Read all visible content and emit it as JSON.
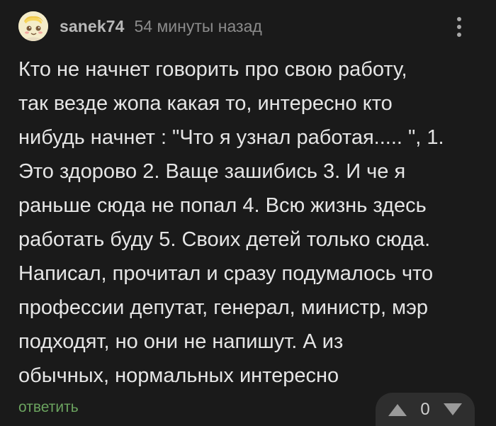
{
  "comment": {
    "author": "sanek74",
    "time": "54 минуты назад",
    "text_lines": [
      "Кто не начнет говорить про свою работу,",
      "так везде жопа какая то, интересно кто",
      "нибудь начнет : \"Что я узнал работая..... \", 1.",
      "Это здорово 2. Ваще зашибись 3. И че я",
      "раньше сюда не попал 4. Всю жизнь здесь",
      "работать буду 5. Своих детей только сюда.",
      "Написал, прочитал и сразу подумалось что",
      "профессии депутат, генерал, министр, мэр",
      "подходят, но они не напишут. А из",
      "обычных, нормальных интересно"
    ],
    "reply_label": "ответить",
    "rating": "0"
  },
  "colors": {
    "background": "#1a1a1a",
    "reply_link": "#6ba35f",
    "vote_box": "#2e2e2e"
  },
  "icons": {
    "avatar": "cartoon-avatar",
    "more": "more-vertical-icon",
    "upvote": "triangle-up-icon",
    "downvote": "triangle-down-icon"
  }
}
